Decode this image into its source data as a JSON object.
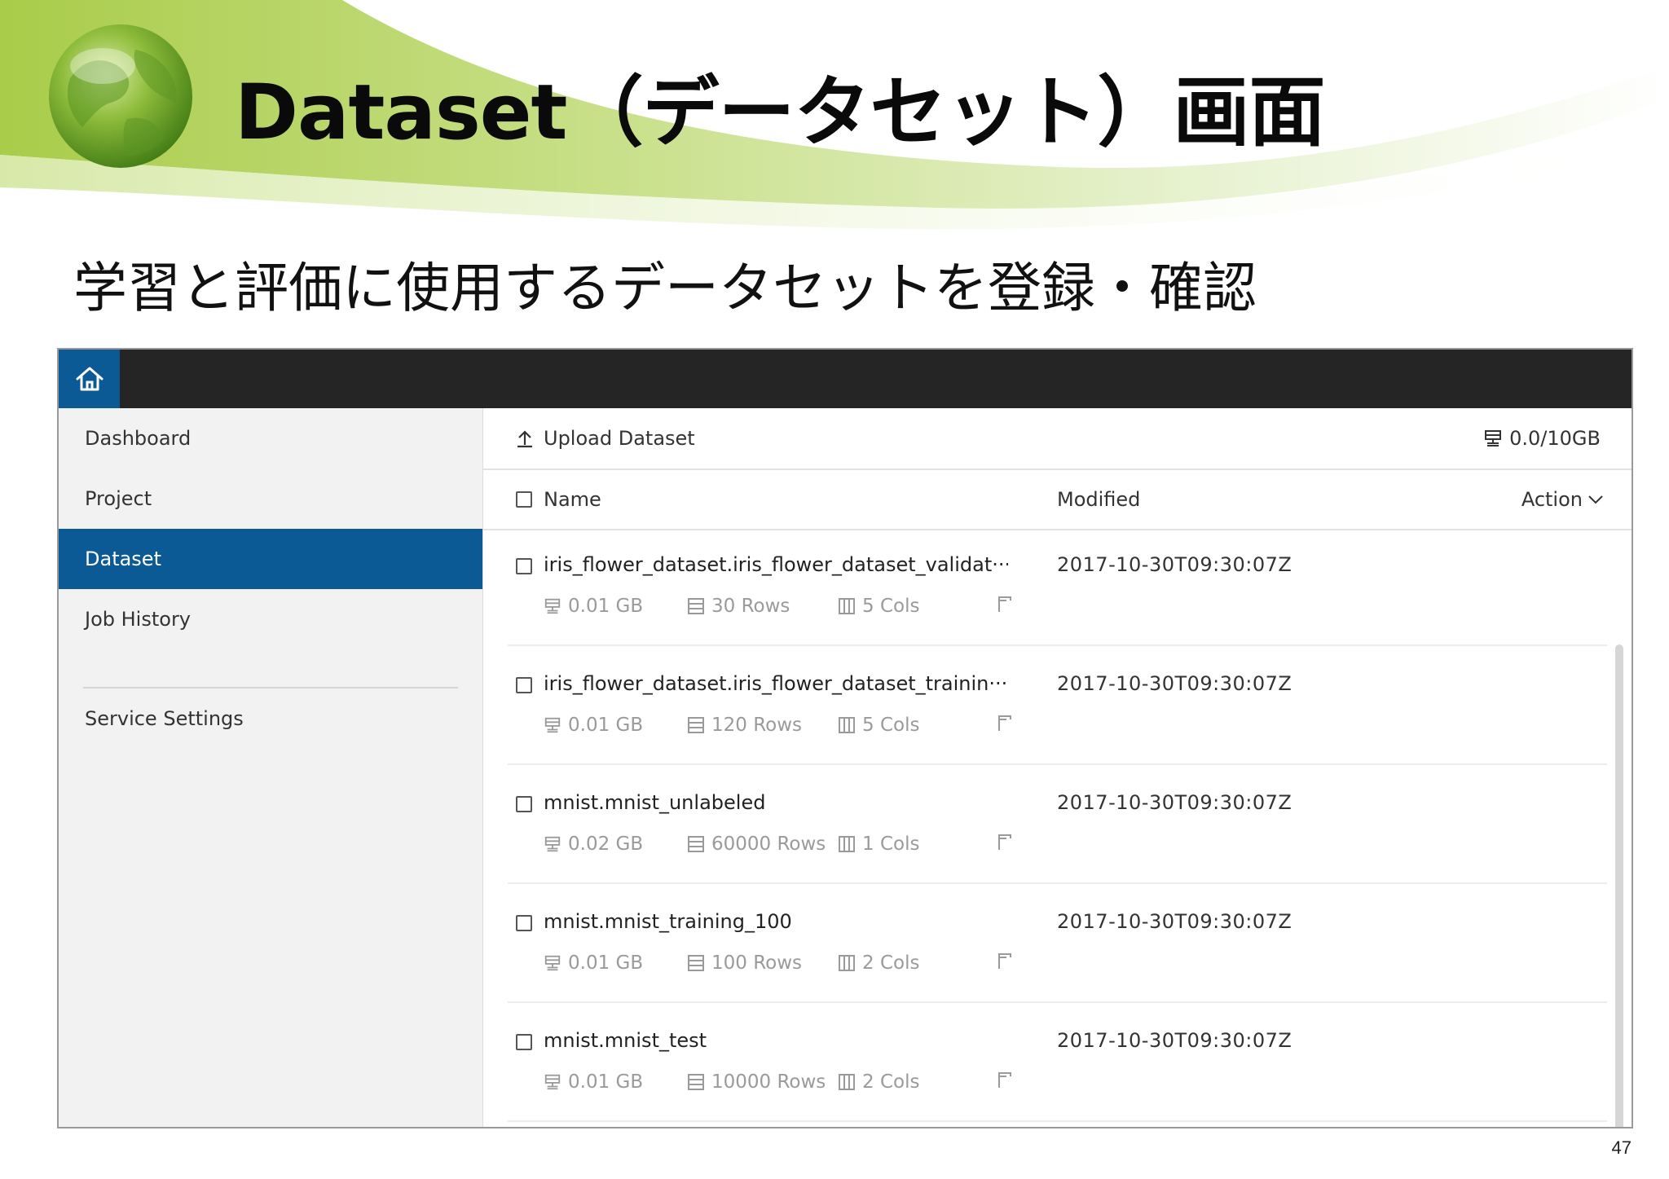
{
  "slide": {
    "title": "Dataset（データセット）画面",
    "subtitle": "学習と評価に使用するデータセットを登録・確認",
    "page_number": "47"
  },
  "app": {
    "home_icon": "home-icon",
    "accent_color": "#0b5a96",
    "sidebar": {
      "items": [
        {
          "label": "Dashboard",
          "active": false
        },
        {
          "label": "Project",
          "active": false
        },
        {
          "label": "Dataset",
          "active": true
        },
        {
          "label": "Job History",
          "active": false
        }
      ],
      "settings_label": "Service Settings"
    },
    "toolbar": {
      "upload_label": "Upload Dataset",
      "storage_usage": "0.0/10GB"
    },
    "list_header": {
      "name": "Name",
      "modified": "Modified",
      "action": "Action"
    },
    "datasets": [
      {
        "name": "iris_flower_dataset.iris_flower_dataset_validat···",
        "modified": "2017-10-30T09:30:07Z",
        "size": "0.01 GB",
        "rows": "30 Rows",
        "cols": "5 Cols"
      },
      {
        "name": "iris_flower_dataset.iris_flower_dataset_trainin···",
        "modified": "2017-10-30T09:30:07Z",
        "size": "0.01 GB",
        "rows": "120 Rows",
        "cols": "5 Cols"
      },
      {
        "name": "mnist.mnist_unlabeled",
        "modified": "2017-10-30T09:30:07Z",
        "size": "0.02 GB",
        "rows": "60000 Rows",
        "cols": "1 Cols"
      },
      {
        "name": "mnist.mnist_training_100",
        "modified": "2017-10-30T09:30:07Z",
        "size": "0.01 GB",
        "rows": "100 Rows",
        "cols": "2 Cols"
      },
      {
        "name": "mnist.mnist_test",
        "modified": "2017-10-30T09:30:07Z",
        "size": "0.01 GB",
        "rows": "10000 Rows",
        "cols": "2 Cols"
      }
    ]
  }
}
